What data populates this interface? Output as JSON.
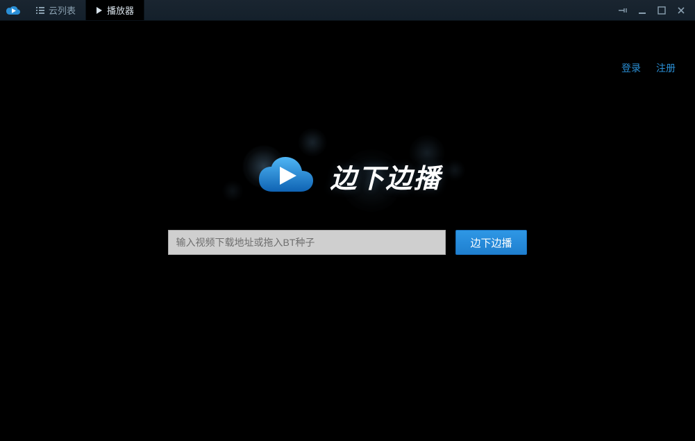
{
  "tabs": {
    "cloud_list": "云列表",
    "player": "播放器"
  },
  "auth": {
    "login": "登录",
    "register": "注册"
  },
  "hero": {
    "brand": "边下边播"
  },
  "search": {
    "placeholder": "输入视频下载地址或拖入BT种子",
    "value": "",
    "button_label": "边下边播"
  }
}
